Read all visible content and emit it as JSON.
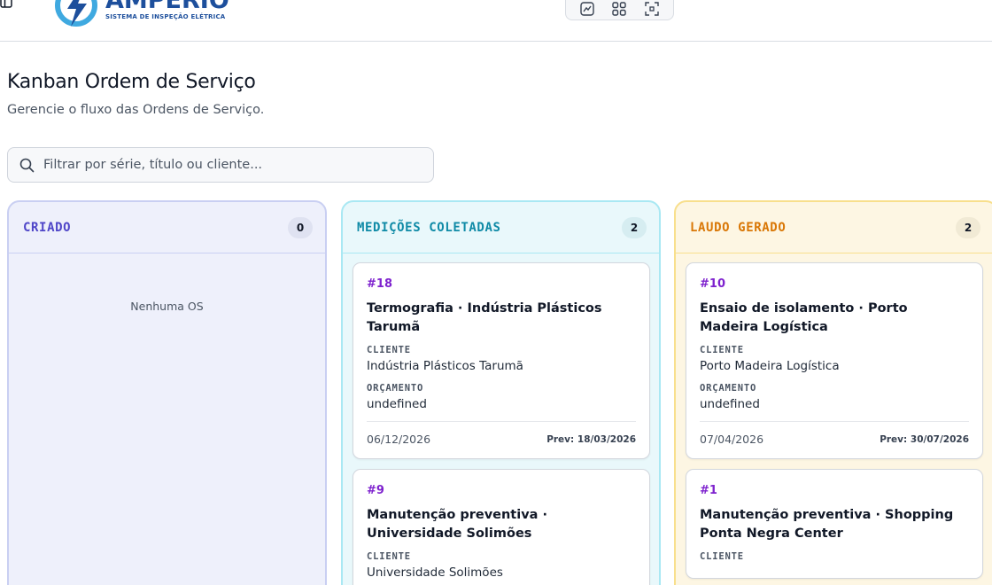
{
  "brand": {
    "name": "AMPERIO",
    "subtitle": "SISTEMA DE INSPEÇÃO ELÉTRICA",
    "colors": {
      "primary": "#1d4f9c",
      "accent": "#3fa9e0"
    }
  },
  "toolbar": {
    "icons": [
      "chart-icon",
      "grid-icon",
      "focus-icon"
    ]
  },
  "header": {
    "title": "Kanban Ordem de Serviço",
    "subtitle": "Gerencie o fluxo das Ordens de Serviço."
  },
  "search": {
    "placeholder": "Filtrar por série, título ou cliente...",
    "value": ""
  },
  "columns": [
    {
      "title": "CRIADO",
      "count": "0",
      "empty_text": "Nenhuma OS",
      "color": "#4f46c8",
      "cards": []
    },
    {
      "title": "MEDIÇÕES COLETADAS",
      "count": "2",
      "color": "#0f8aa6",
      "cards": [
        {
          "id": "#18",
          "title": "Termografia · Indústria Plásticos Tarumã",
          "client_label": "CLIENTE",
          "client": "Indústria Plásticos Tarumã",
          "budget_label": "ORÇAMENTO",
          "budget": "undefined",
          "date": "06/12/2026",
          "prev": "Prev: 18/03/2026"
        },
        {
          "id": "#9",
          "title": "Manutenção preventiva · Universidade Solimões",
          "client_label": "CLIENTE",
          "client": "Universidade Solimões"
        }
      ]
    },
    {
      "title": "LAUDO GERADO",
      "count": "2",
      "color": "#d97706",
      "cards": [
        {
          "id": "#10",
          "title": "Ensaio de isolamento · Porto Madeira Logística",
          "client_label": "CLIENTE",
          "client": "Porto Madeira Logística",
          "budget_label": "ORÇAMENTO",
          "budget": "undefined",
          "date": "07/04/2026",
          "prev": "Prev: 30/07/2026"
        },
        {
          "id": "#1",
          "title": "Manutenção preventiva · Shopping Ponta Negra Center",
          "client_label": "CLIENTE"
        }
      ]
    }
  ]
}
